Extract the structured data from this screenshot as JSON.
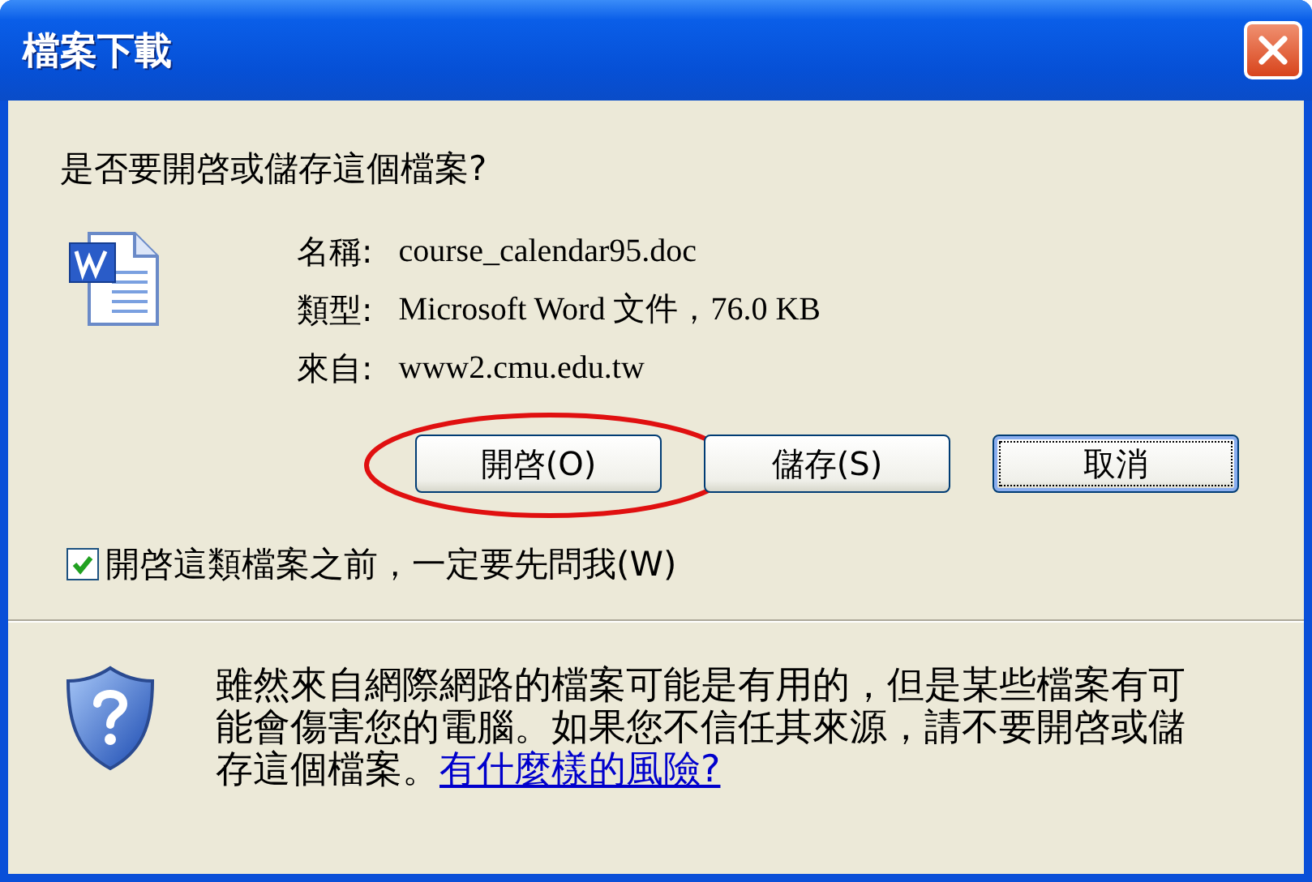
{
  "window": {
    "title": "檔案下載"
  },
  "question": "是否要開啓或儲存這個檔案?",
  "file_info": [
    {
      "label": "名稱:",
      "value": "course_calendar95.doc"
    },
    {
      "label": "類型:",
      "value": "Microsoft Word 文件，76.0 KB"
    },
    {
      "label": "來自:",
      "value": "www2.cmu.edu.tw"
    }
  ],
  "buttons": [
    {
      "label": "開啓(O)",
      "focused": false,
      "annotated": true
    },
    {
      "label": "儲存(S)",
      "focused": false,
      "annotated": false
    },
    {
      "label": "取消",
      "focused": true,
      "annotated": false
    }
  ],
  "checkbox": {
    "label": "開啓這類檔案之前，一定要先問我(W)",
    "checked": true
  },
  "warning": {
    "text": "雖然來自網際網路的檔案可能是有用的，但是某些檔案有可能會傷害您的電腦。如果您不信任其來源，請不要開啓或儲存這個檔案。",
    "link": "有什麼樣的風險?"
  }
}
